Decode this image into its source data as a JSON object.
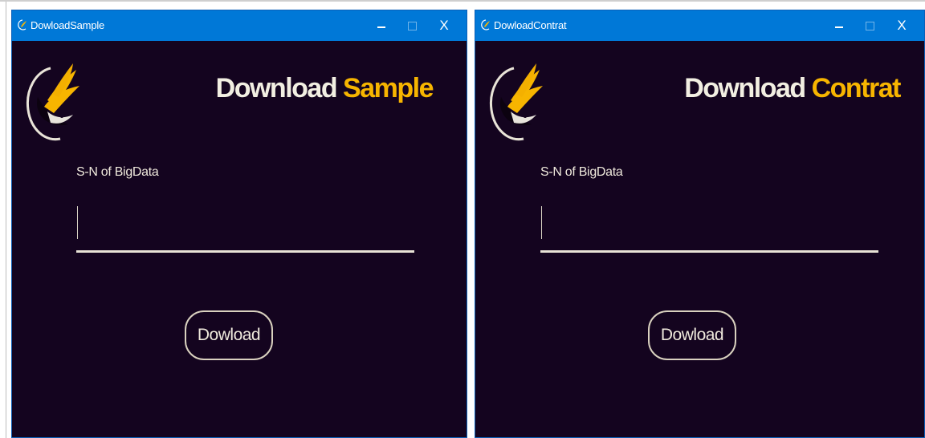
{
  "windows": [
    {
      "title": "DowloadSample",
      "controls": {
        "minimize": "–",
        "close": "X"
      },
      "heading_word1": "Download",
      "heading_word2": "Sample",
      "field_label": "S-N of BigData",
      "field_value": "",
      "button_label": "Dowload"
    },
    {
      "title": "DowloadContrat",
      "controls": {
        "minimize": "–",
        "close": "X"
      },
      "heading_word1": "Download",
      "heading_word2": "Contrat",
      "field_label": "S-N of BigData",
      "field_value": "",
      "button_label": "Dowload"
    }
  ],
  "icons": {
    "app": "flame-bird-logo-icon",
    "minimize": "minimize-icon",
    "maximize": "maximize-icon",
    "close": "close-icon"
  },
  "colors": {
    "window_bg": "#14041f",
    "titlebar_bg": "#0078d7",
    "accent": "#f7b500",
    "text": "#efe9dc"
  }
}
